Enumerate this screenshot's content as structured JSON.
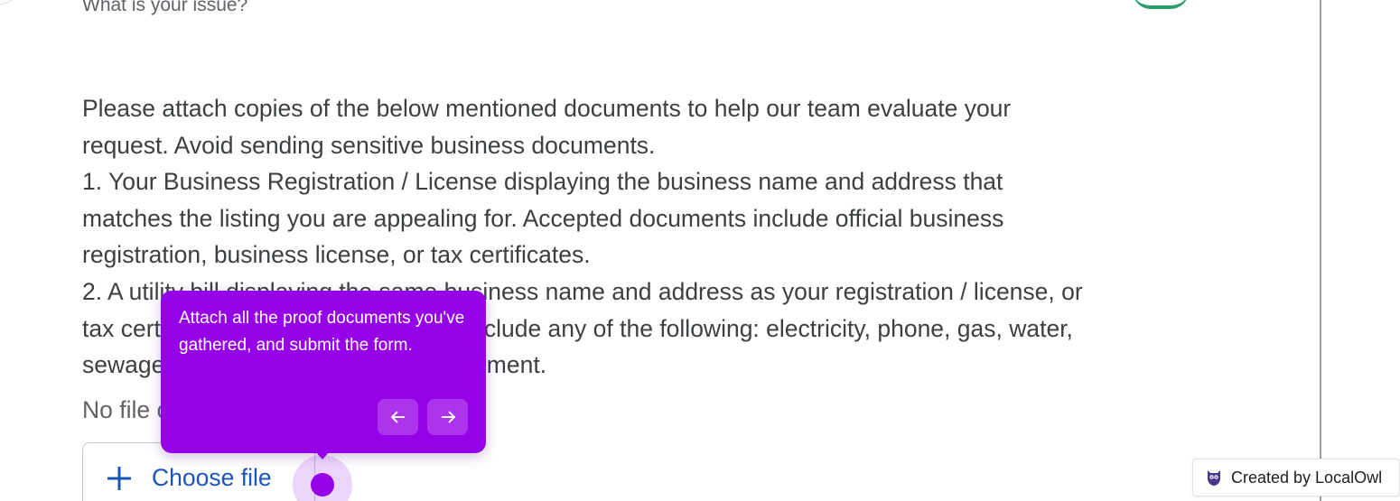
{
  "form": {
    "question_label": "What is your issue?",
    "instructions": [
      "Please attach copies of the below mentioned documents to help our team evaluate your",
      "request. Avoid sending sensitive business documents.",
      "1. Your Business Registration / License displaying the business name and address that",
      "matches the listing you are appealing for. Accepted documents include official business",
      "registration, business license, or tax certificates.",
      "2. A utility bill displaying the same business name and address as your registration / license, or",
      "tax certificate. Accepted documents include any of the following: electricity, phone, gas, water,",
      "sewage, or internet bill or a bank statement."
    ],
    "file_status": "No file chosen",
    "choose_file_label": "Choose file",
    "choose_file_icon": "plus-icon"
  },
  "walkthrough": {
    "tooltip_text": "Attach all the proof documents you've gathered, and submit the form.",
    "prev_icon": "arrow-left-icon",
    "next_icon": "arrow-right-icon",
    "accent_color": "#9602e8"
  },
  "badge": {
    "label": "Created by LocalOwl",
    "icon": "owl-icon"
  },
  "colors": {
    "body_text": "#3c4043",
    "muted_text": "#5f6368",
    "link_blue": "#1a56b8"
  }
}
